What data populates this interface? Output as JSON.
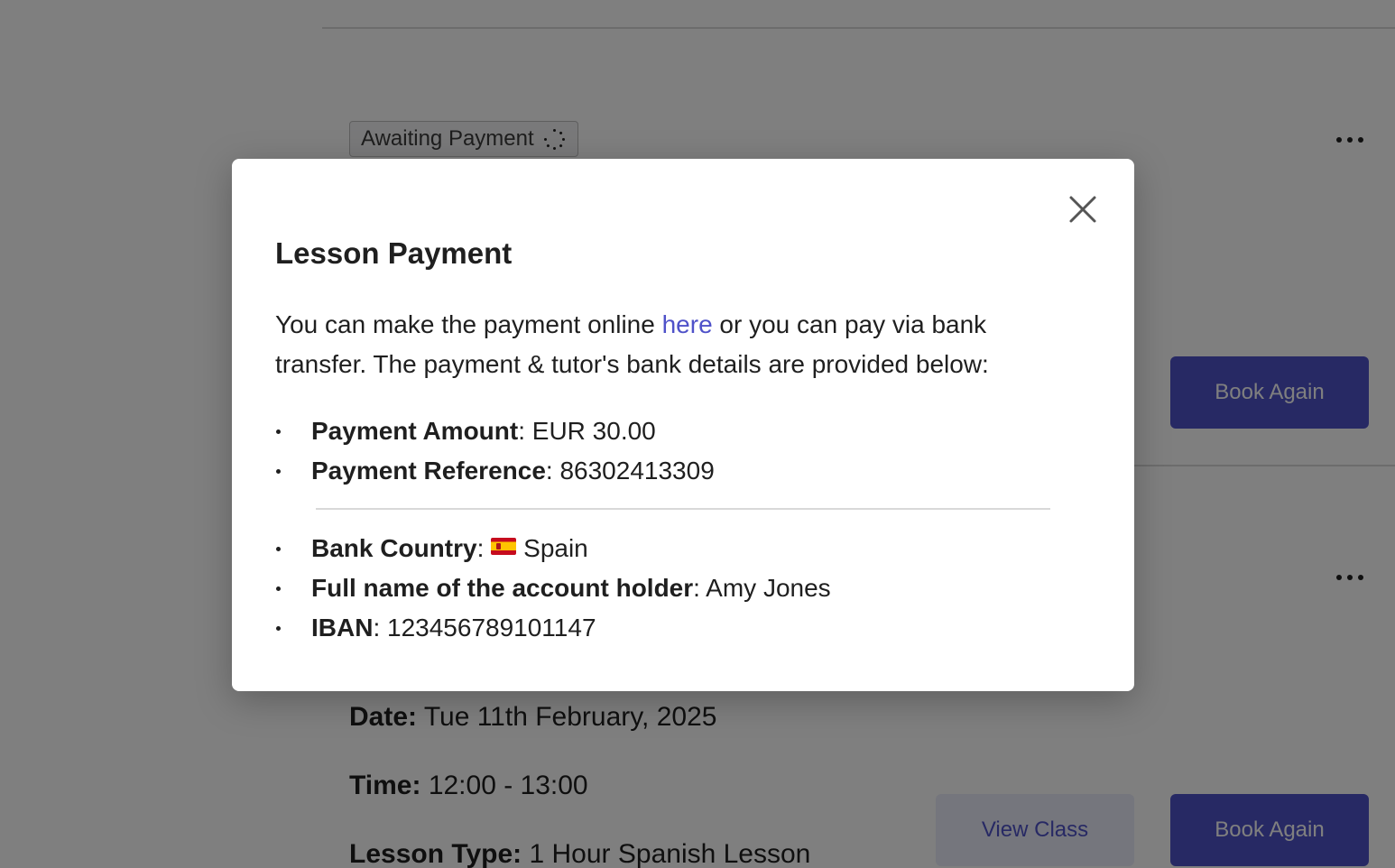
{
  "background": {
    "status_badge": "Awaiting Payment",
    "card1": {
      "book_again_label": "Book Again"
    },
    "card2": {
      "date_label": "Date:",
      "date_value": "Tue 11th February, 2025",
      "time_label": "Time:",
      "time_value": "12:00 - 13:00",
      "lesson_type_label": "Lesson Type:",
      "lesson_type_value": "1 Hour Spanish Lesson",
      "view_class_label": "View Class",
      "book_again_label": "Book Again"
    },
    "icons": {
      "more": "more-icon",
      "spinner": "spinner-icon"
    }
  },
  "modal": {
    "title": "Lesson Payment",
    "intro_before_link": "You can make the payment online ",
    "link_text": "here",
    "intro_after_link": " or you can pay via bank transfer. The payment & tutor's bank details are provided below:",
    "payment_details": [
      {
        "label": "Payment Amount",
        "value": "EUR 30.00"
      },
      {
        "label": "Payment Reference",
        "value": "86302413309"
      }
    ],
    "bank_details": {
      "country_label": "Bank Country",
      "country_value": "Spain",
      "country_flag": "spain-flag-icon",
      "holder_label": "Full name of the account holder",
      "holder_value": "Amy Jones",
      "iban_label": "IBAN",
      "iban_value": "123456789101147"
    },
    "close_icon": "close-icon"
  },
  "colors": {
    "accent": "#4f52c9",
    "overlay": "rgba(0,0,0,0.5)",
    "text": "#1f1f1f"
  }
}
